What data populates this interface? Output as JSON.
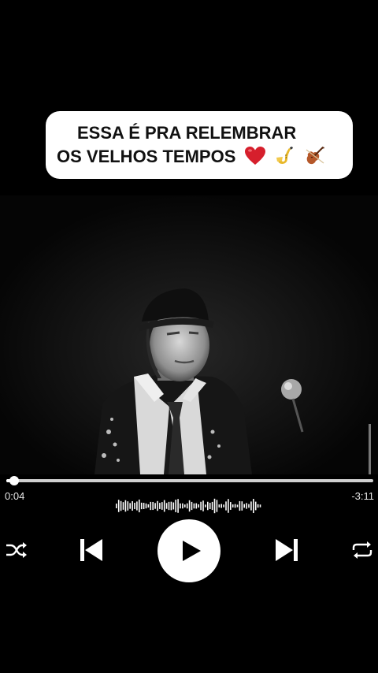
{
  "caption": {
    "line1": "ESSA É PRA RELEMBRAR",
    "line2": "OS VELHOS TEMPOS",
    "emojis": [
      "heart-emoji",
      "saxophone-emoji",
      "violin-emoji"
    ]
  },
  "player": {
    "progress": 0.021,
    "elapsed": "0:04",
    "remaining": "-3:11"
  },
  "controls": {
    "icons": [
      "shuffle-icon",
      "previous-icon",
      "play-icon",
      "next-icon",
      "repeat-icon"
    ]
  },
  "colors": {
    "background": "#000000",
    "caption_bg": "#ffffff",
    "caption_text": "#111111",
    "heart": "#d61f2c"
  }
}
